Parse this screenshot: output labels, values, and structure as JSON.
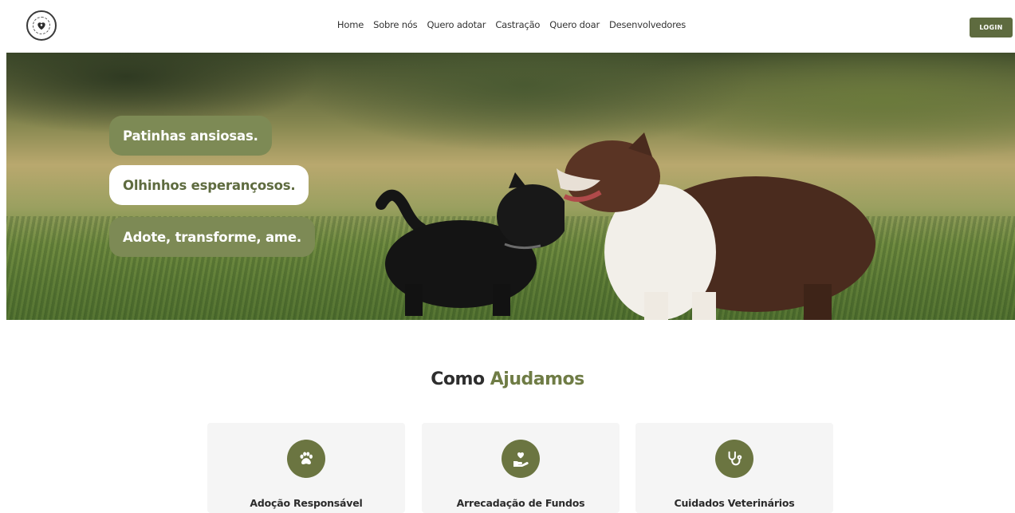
{
  "header": {
    "nav": [
      "Home",
      "Sobre nós",
      "Quero adotar",
      "Castração",
      "Quero doar",
      "Desenvolvedores"
    ],
    "login_label": "LOGIN"
  },
  "hero": {
    "taglines": [
      "Patinhas ansiosas.",
      "Olhinhos esperançosos.",
      "Adote, transforme, ame."
    ]
  },
  "section": {
    "title_part1": "Como",
    "title_part2": "Ajudamos"
  },
  "cards": [
    {
      "title": "Adoção Responsável",
      "icon": "paw-icon"
    },
    {
      "title": "Arrecadação de Fundos",
      "icon": "hand-heart-icon"
    },
    {
      "title": "Cuidados Veterinários",
      "icon": "stethoscope-icon"
    }
  ],
  "colors": {
    "brand": "#5e6b3f",
    "pill": "#7d8a55",
    "accent": "#6f7c45",
    "card_bg": "#f5f5f5"
  }
}
